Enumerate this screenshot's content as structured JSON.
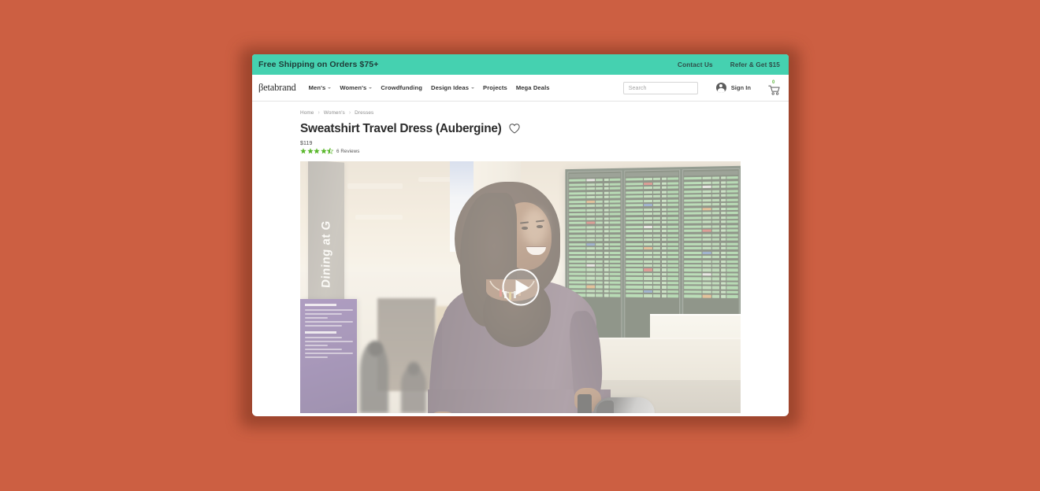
{
  "theme": {
    "page_background": "#cc5f42",
    "promo_background": "#45d1b0",
    "star_color": "#5cb82e",
    "cart_badge_color": "#62b843"
  },
  "promo": {
    "message": "Free Shipping on Orders $75+",
    "links": [
      {
        "label": "Contact Us"
      },
      {
        "label": "Refer & Get $15"
      }
    ]
  },
  "nav": {
    "logo": "βetabrand",
    "items": [
      {
        "label": "Men's",
        "has_dropdown": true
      },
      {
        "label": "Women's",
        "has_dropdown": true
      },
      {
        "label": "Crowdfunding",
        "has_dropdown": false
      },
      {
        "label": "Design Ideas",
        "has_dropdown": true
      },
      {
        "label": "Projects",
        "has_dropdown": false
      },
      {
        "label": "Mega Deals",
        "has_dropdown": false
      }
    ],
    "search": {
      "placeholder": "Search",
      "value": ""
    },
    "account": {
      "icon": "user-avatar-icon",
      "label": "Sign In"
    },
    "cart": {
      "icon": "shopping-cart-icon",
      "count": "0"
    }
  },
  "breadcrumb": {
    "items": [
      {
        "label": "Home"
      },
      {
        "label": "Women's"
      },
      {
        "label": "Dresses"
      }
    ],
    "separator": "›"
  },
  "product": {
    "title": "Sweatshirt Travel Dress (Aubergine)",
    "wishlist_icon": "heart-outline-icon",
    "price": "$119",
    "rating": {
      "value": 4.5,
      "max": 5,
      "full_stars": 4,
      "half_stars": 1,
      "reviews_label": "6 Reviews"
    },
    "media": {
      "type": "video",
      "play_icon": "play-triangle-icon",
      "scene_description": "Woman in aubergine sweatshirt travel dress walking through an airport terminal with a rolling bag and gray backpack",
      "signage": {
        "dining_sign": "Dining at G"
      }
    }
  }
}
